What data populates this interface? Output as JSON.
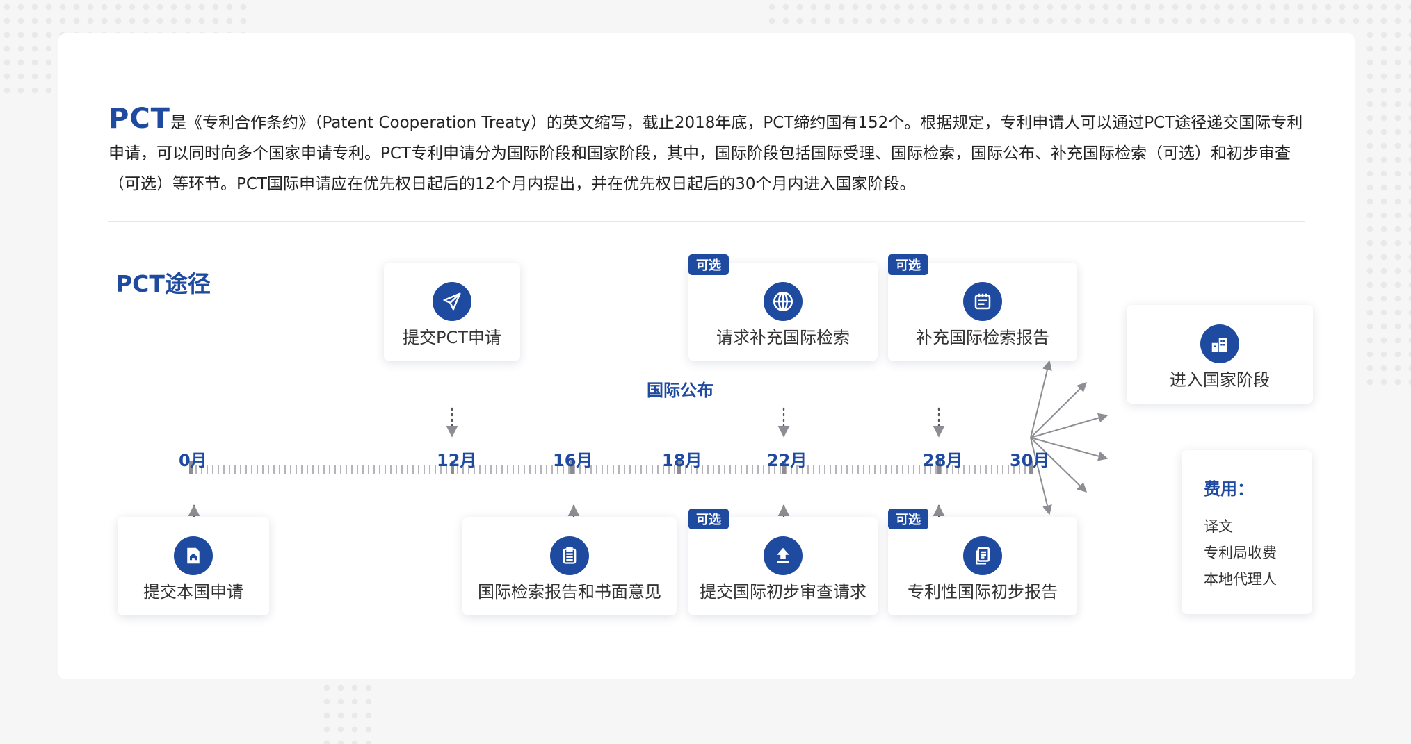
{
  "intro": {
    "lead": "PCT",
    "text": "是《专利合作条约》（Patent Cooperation Treaty）的英文缩写，截止2018年底，PCT缔约国有152个。根据规定，专利申请人可以通过PCT途径递交国际专利申请，可以同时向多个国家申请专利。PCT专利申请分为国际阶段和国家阶段，其中，国际阶段包括国际受理、国际检索，国际公布、补充国际检索（可选）和初步审查（可选）等环节。PCT国际申请应在优先权日起后的12个月内提出，并在优先权日起后的30个月内进入国家阶段。"
  },
  "route_title": "PCT途径",
  "publication_label": "国际公布",
  "optional_tag": "可选",
  "months": [
    "0月",
    "12月",
    "16月",
    "18月",
    "22月",
    "28月",
    "30月"
  ],
  "top_steps": [
    {
      "label": "提交PCT申请",
      "icon": "send-icon",
      "optional": false
    },
    {
      "label": "请求补充国际检索",
      "icon": "globe-icon",
      "optional": true
    },
    {
      "label": "补充国际检索报告",
      "icon": "calendar-report-icon",
      "optional": true
    }
  ],
  "bottom_steps": [
    {
      "label": "提交本国申请",
      "icon": "house-document-icon",
      "optional": false
    },
    {
      "label": "国际检索报告和书面意见",
      "icon": "clipboard-icon",
      "optional": false
    },
    {
      "label": "提交国际初步审查请求",
      "icon": "upload-icon",
      "optional": true
    },
    {
      "label": "专利性国际初步报告",
      "icon": "documents-icon",
      "optional": true
    }
  ],
  "national_phase": {
    "label": "进入国家阶段",
    "icon": "building-icon"
  },
  "fees": {
    "title": "费用：",
    "items": [
      "译文",
      "专利局收费",
      "本地代理人"
    ]
  },
  "colors": {
    "brand": "#1e4aa0",
    "tick": "#9a9aa0",
    "background": "#f6f6f7"
  }
}
